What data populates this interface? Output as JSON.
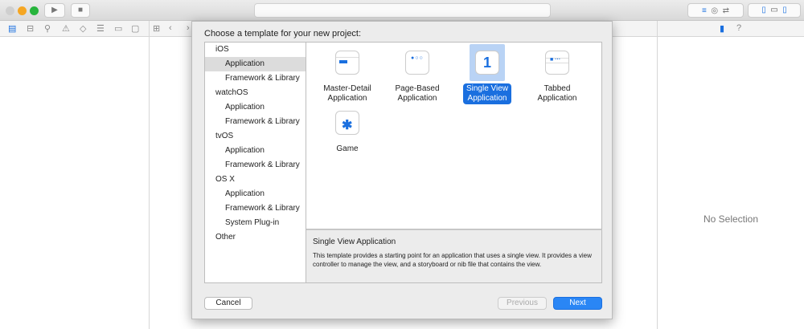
{
  "window": {
    "controls": [
      "close",
      "minimize",
      "zoom"
    ]
  },
  "toolbar": {
    "run": "▶",
    "stop": "■"
  },
  "sheet": {
    "title": "Choose a template for your new project:",
    "categories": [
      {
        "label": "iOS",
        "sub": false
      },
      {
        "label": "Application",
        "sub": true,
        "selected": true
      },
      {
        "label": "Framework & Library",
        "sub": true
      },
      {
        "label": "watchOS",
        "sub": false
      },
      {
        "label": "Application",
        "sub": true
      },
      {
        "label": "Framework & Library",
        "sub": true
      },
      {
        "label": "tvOS",
        "sub": false
      },
      {
        "label": "Application",
        "sub": true
      },
      {
        "label": "Framework & Library",
        "sub": true
      },
      {
        "label": "OS X",
        "sub": false
      },
      {
        "label": "Application",
        "sub": true
      },
      {
        "label": "Framework & Library",
        "sub": true
      },
      {
        "label": "System Plug-in",
        "sub": true
      },
      {
        "label": "Other",
        "sub": false
      }
    ],
    "templates": [
      {
        "l1": "Master-Detail",
        "l2": "Application"
      },
      {
        "l1": "Page-Based",
        "l2": "Application"
      },
      {
        "l1": "Single View",
        "l2": "Application",
        "selected": true,
        "glyph": "1"
      },
      {
        "l1": "Tabbed",
        "l2": "Application"
      },
      {
        "l1": "Game",
        "l2": ""
      }
    ],
    "description": {
      "title": "Single View Application",
      "text": "This template provides a starting point for an application that uses a single view. It provides a view controller to manage the view, and a storyboard or nib file that contains the view."
    },
    "cancel": "Cancel",
    "previous": "Previous",
    "next": "Next"
  },
  "inspector": {
    "empty": "No Selection"
  },
  "colors": {
    "accent": "#1a6fdf"
  }
}
